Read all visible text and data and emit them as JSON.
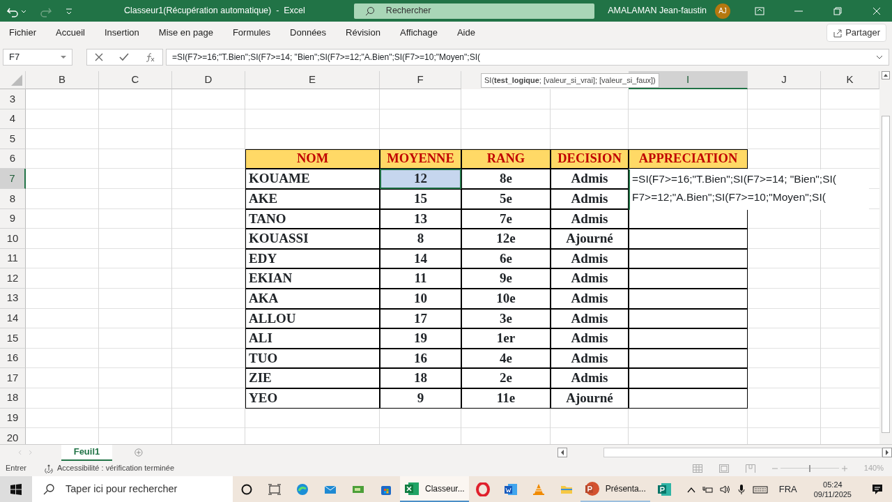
{
  "window": {
    "title": "Classeur1(Récupération automatique)  -  Excel",
    "search": "Rechercher",
    "user": "AMALAMAN Jean-faustin",
    "avatar": "AJ"
  },
  "ribbon_tabs": [
    {
      "label": "Fichier",
      "selected": false
    },
    {
      "label": "Accueil",
      "selected": false
    },
    {
      "label": "Insertion",
      "selected": false
    },
    {
      "label": "Mise en page",
      "selected": false
    },
    {
      "label": "Formules",
      "selected": false
    },
    {
      "label": "Données",
      "selected": false
    },
    {
      "label": "Révision",
      "selected": false
    },
    {
      "label": "Affichage",
      "selected": false
    },
    {
      "label": "Aide",
      "selected": false
    }
  ],
  "share_button": "Partager",
  "formula_bar": {
    "name_box": "F7",
    "formula": "=SI(F7>=16;\"T.Bien\";SI(F7>=14; \"Bien\";SI(F7>=12;\"A.Bien\";SI(F7>=10;\"Moyen\";SI(",
    "tooltip_prefix": "SI(",
    "tooltip_bold": "test_logique",
    "tooltip_rest": "; [valeur_si_vrai]; [valeur_si_faux])"
  },
  "column_headers": [
    {
      "label": "B",
      "active": false
    },
    {
      "label": "C",
      "active": false
    },
    {
      "label": "D",
      "active": false
    },
    {
      "label": "E",
      "active": false
    },
    {
      "label": "F",
      "active": false
    },
    {
      "label": "I",
      "active": true
    },
    {
      "label": "J",
      "active": false
    },
    {
      "label": "K",
      "active": false
    }
  ],
  "rows": [
    {
      "number": "3",
      "kind": "empty"
    },
    {
      "number": "4",
      "kind": "empty"
    },
    {
      "number": "5",
      "kind": "empty"
    },
    {
      "number": "6",
      "kind": "header",
      "cells": [
        "NOM",
        "MOYENNE",
        "RANG",
        "DECISION",
        "APPRECIATION"
      ]
    },
    {
      "number": "7",
      "kind": "data",
      "selected": true,
      "cells": [
        "KOUAME",
        "12",
        "8e",
        "Admis"
      ]
    },
    {
      "number": "8",
      "kind": "data",
      "selected": false,
      "cells": [
        "AKE",
        "15",
        "5e",
        "Admis"
      ]
    },
    {
      "number": "9",
      "kind": "data",
      "selected": false,
      "cells": [
        "TANO",
        "13",
        "7e",
        "Admis"
      ]
    },
    {
      "number": "10",
      "kind": "data",
      "selected": false,
      "cells": [
        "KOUASSI",
        "8",
        "12e",
        "Ajourné"
      ]
    },
    {
      "number": "11",
      "kind": "data",
      "selected": false,
      "cells": [
        "EDY",
        "14",
        "6e",
        "Admis"
      ]
    },
    {
      "number": "12",
      "kind": "data",
      "selected": false,
      "cells": [
        "EKIAN",
        "11",
        "9e",
        "Admis"
      ]
    },
    {
      "number": "13",
      "kind": "data",
      "selected": false,
      "cells": [
        "AKA",
        "10",
        "10e",
        "Admis"
      ]
    },
    {
      "number": "14",
      "kind": "data",
      "selected": false,
      "cells": [
        "ALLOU",
        "17",
        "3e",
        "Admis"
      ]
    },
    {
      "number": "15",
      "kind": "data",
      "selected": false,
      "cells": [
        "ALI",
        "19",
        "1er",
        "Admis"
      ]
    },
    {
      "number": "16",
      "kind": "data",
      "selected": false,
      "cells": [
        "TUO",
        "16",
        "4e",
        "Admis"
      ]
    },
    {
      "number": "17",
      "kind": "data",
      "selected": false,
      "cells": [
        "ZIE",
        "18",
        "2e",
        "Admis"
      ]
    },
    {
      "number": "18",
      "kind": "data",
      "selected": false,
      "cells": [
        "YEO",
        "9",
        "11e",
        "Ajourné"
      ]
    },
    {
      "number": "19",
      "kind": "empty"
    },
    {
      "number": "20",
      "kind": "empty"
    }
  ],
  "cell_editor": "=SI(F7>=16;\"T.Bien\";SI(F7>=14; \"Bien\";SI( F7>=12;\"A.Bien\";SI(F7>=10;\"Moyen\";SI(",
  "sheet_tabs": [
    {
      "label": "Feuil1",
      "selected": true
    }
  ],
  "status_bar": {
    "mode": "Entrer",
    "accessibility": "Accessibilité : vérification terminée",
    "zoom": "140%",
    "zoom_slider": {
      "level": 0.5
    }
  },
  "taskbar": {
    "search_placeholder": "Taper ici pour rechercher",
    "apps": [
      {
        "label": "Classeur...",
        "active": true
      },
      {
        "label": "Présenta...",
        "active": false
      }
    ],
    "language": "FRA",
    "time": "05:24",
    "date": "09/11/2025"
  }
}
